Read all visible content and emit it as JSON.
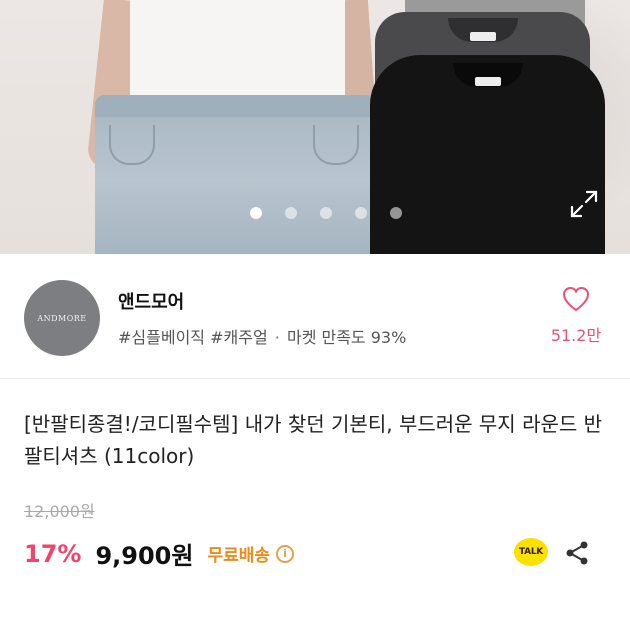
{
  "hero": {
    "carousel_dots": 5,
    "active_dot": 0
  },
  "seller": {
    "logo_text": "ANDMORE",
    "name": "앤드모어",
    "tags": [
      "#심플베이직",
      "#캐주얼"
    ],
    "separator": "·",
    "satisfaction": "마켓 만족도 93%",
    "like_count": "51.2만"
  },
  "product": {
    "title": "[반팔티종결!/코디필수템] 내가 찾던 기본티, 부드러운 무지 라운드 반팔티셔츠 (11color)",
    "original_price": "12,000원",
    "discount": "17%",
    "price": "9,900원",
    "shipping": "무료배송",
    "info_icon_label": "i"
  },
  "actions": {
    "talk_label": "TALK"
  },
  "colors": {
    "accent_pink": "#f0446a",
    "shipping_orange": "#f08a17",
    "kakao_yellow": "#fae100"
  },
  "icons": [
    "expand-icon",
    "heart-icon",
    "info-icon",
    "kakao-talk-icon",
    "share-icon"
  ]
}
